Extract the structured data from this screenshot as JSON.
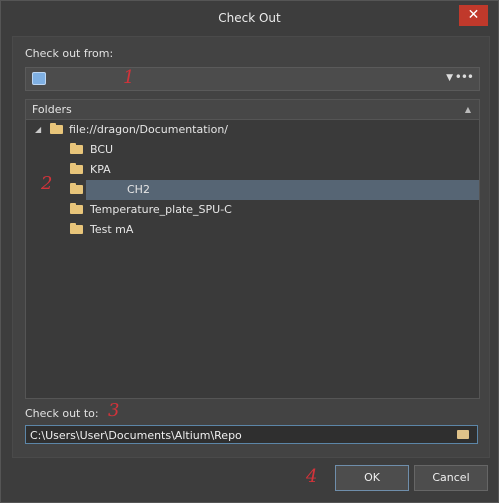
{
  "window": {
    "title": "Check Out",
    "close_glyph": "✕"
  },
  "checkout_from": {
    "label": "Check out from:",
    "selected_value": "",
    "icon": "repository-icon",
    "more_glyph": "•••"
  },
  "folders": {
    "header": "Folders",
    "root": {
      "label": "file://dragon/Documentation/",
      "expanded": true
    },
    "items": [
      {
        "label": "BCU",
        "selected": false
      },
      {
        "label": "KPA",
        "selected": false
      },
      {
        "label": "CH2",
        "selected": true
      },
      {
        "label": "Temperature_plate_SPU-C",
        "selected": false
      },
      {
        "label": "Test mA",
        "selected": false
      }
    ]
  },
  "checkout_to": {
    "label": "Check out to:",
    "value": "C:\\Users\\User\\Documents\\Altium\\Repo"
  },
  "buttons": {
    "ok": "OK",
    "cancel": "Cancel"
  },
  "annotations": [
    "1",
    "2",
    "3",
    "4"
  ],
  "colors": {
    "close_button": "#c0392b",
    "selection": "#566574",
    "folder": "#e8c57a",
    "annotation": "#d2333a"
  }
}
